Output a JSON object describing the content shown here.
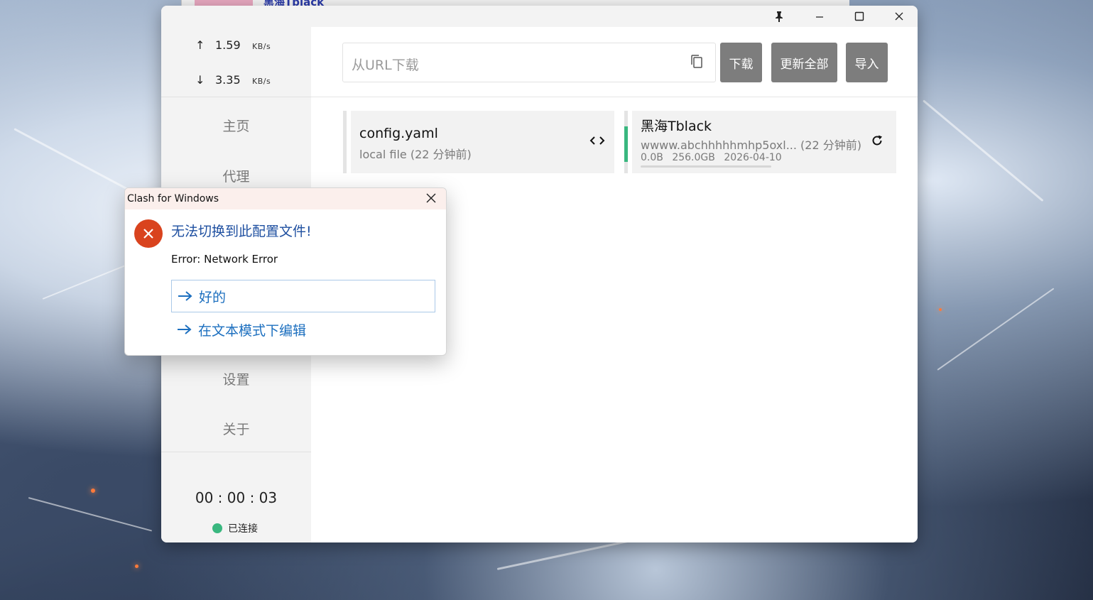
{
  "background_browser": {
    "tab_title": "黑海Tblack"
  },
  "window": {
    "controls": [
      "pin-icon",
      "minimize-icon",
      "maximize-icon",
      "close-icon"
    ]
  },
  "sidebar": {
    "upload": {
      "arrow": "↑",
      "value": "1.59",
      "unit": "KB/s"
    },
    "download": {
      "arrow": "↓",
      "value": "3.35",
      "unit": "KB/s"
    },
    "nav": [
      {
        "label": "主页"
      },
      {
        "label": "代理"
      },
      {
        "label": "设置"
      },
      {
        "label": "关于"
      }
    ],
    "timer": "00 : 00 : 03",
    "status_label": "已连接",
    "status_color": "#39b77f"
  },
  "toolbar": {
    "url_placeholder": "从URL下载",
    "download_label": "下载",
    "update_all_label": "更新全部",
    "import_label": "导入",
    "button_color": "#7d7d7d"
  },
  "profiles": [
    {
      "name": "config.yaml",
      "subtitle": "local file (22 分钟前)",
      "action_icon": "code-icon",
      "active": false
    },
    {
      "name": "黑海Tblack",
      "subtitle": "wwww.abchhhhhmhp5oxl... (22 分钟前)",
      "used": "0.0B",
      "total": "256.0GB",
      "expire": "2026-04-10",
      "action_icon": "refresh-icon",
      "active": true,
      "active_color": "#39b77f"
    }
  ],
  "dialog": {
    "title": "Clash for Windows",
    "heading": "无法切换到此配置文件!",
    "message": "Error: Network Error",
    "options": [
      {
        "label": "好的"
      },
      {
        "label": "在文本模式下编辑"
      }
    ],
    "icon_color": "#d9431e"
  }
}
